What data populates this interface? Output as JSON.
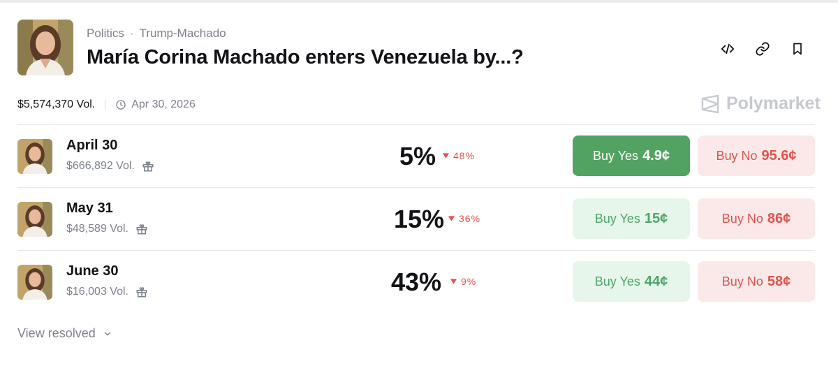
{
  "header": {
    "category": "Politics",
    "separator": "·",
    "subcategory": "Trump-Machado",
    "title": "María Corina Machado enters Venezuela by...?"
  },
  "actions": {
    "embed_icon": "code-icon",
    "link_icon": "link-icon",
    "bookmark_icon": "bookmark-icon"
  },
  "meta": {
    "volume": "$5,574,370 Vol.",
    "end_date": "Apr 30, 2026"
  },
  "brand": {
    "name": "Polymarket"
  },
  "markets": [
    {
      "name": "April 30",
      "volume": "$666,892 Vol.",
      "percent": "5%",
      "change": "48%",
      "yes_label": "Buy Yes",
      "yes_price": "4.9¢",
      "no_label": "Buy No",
      "no_price": "95.6¢"
    },
    {
      "name": "May 31",
      "volume": "$48,589 Vol.",
      "percent": "15%",
      "change": "36%",
      "yes_label": "Buy Yes",
      "yes_price": "15¢",
      "no_label": "Buy No",
      "no_price": "86¢"
    },
    {
      "name": "June 30",
      "volume": "$16,003 Vol.",
      "percent": "43%",
      "change": "9%",
      "yes_label": "Buy Yes",
      "yes_price": "44¢",
      "no_label": "Buy No",
      "no_price": "58¢"
    }
  ],
  "footer": {
    "view_resolved": "View resolved"
  },
  "colors": {
    "yes": "#52a262",
    "yes_light": "#e6f6ea",
    "no": "#e0524c",
    "no_light": "#fbe9e9"
  }
}
